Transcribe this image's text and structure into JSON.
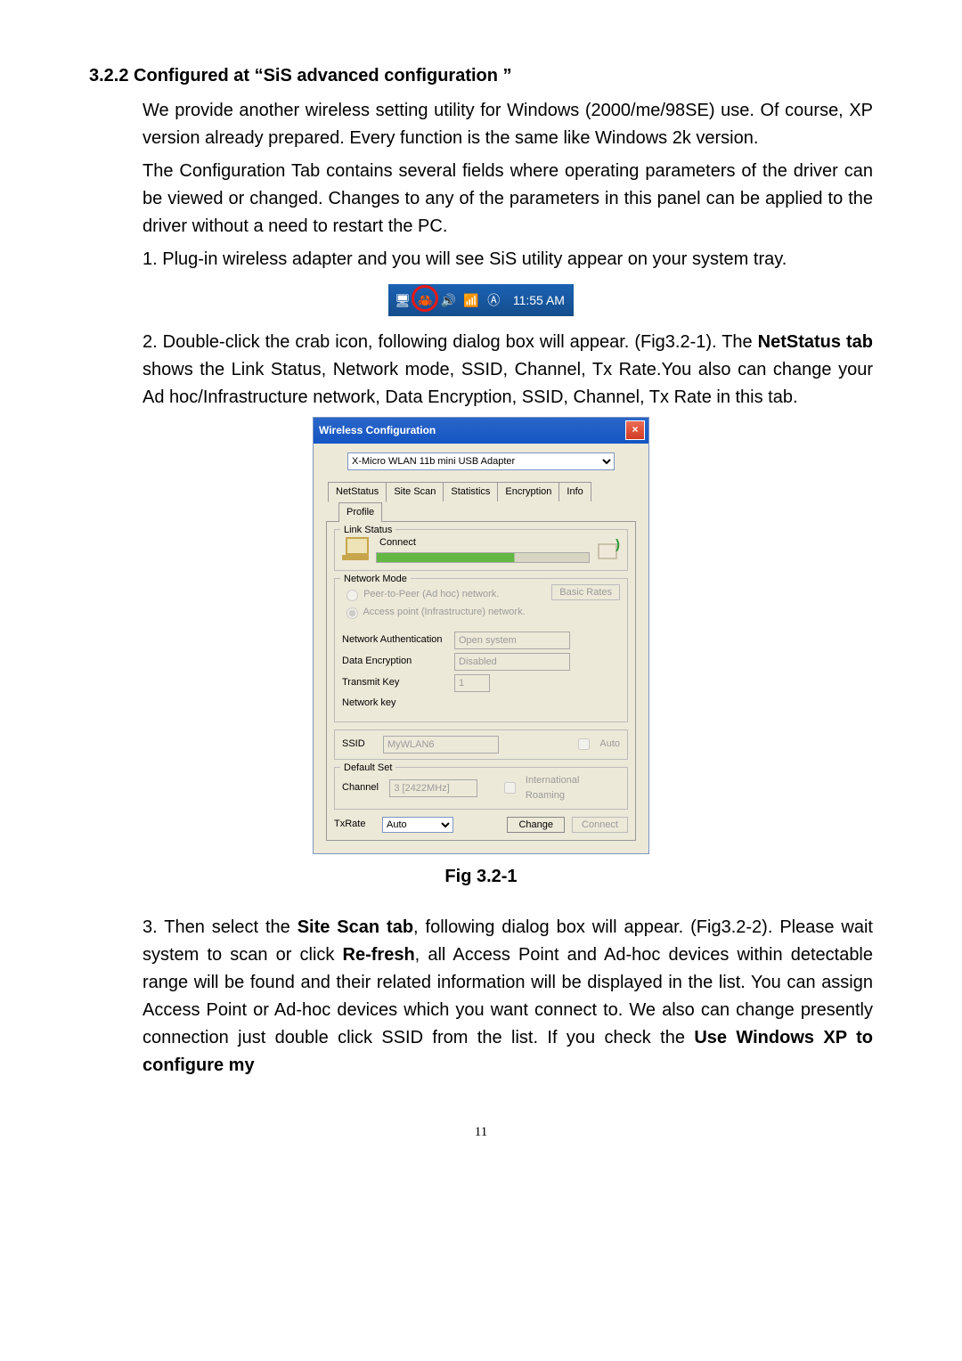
{
  "section_heading": "3.2.2 Configured at “SiS advanced configuration ”",
  "p1": "We provide another wireless setting utility for Windows (2000/me/98SE) use. Of course, XP version already prepared. Every function is the same like Windows 2k version.",
  "p2": "The Configuration Tab contains several fields where operating parameters of the driver can be viewed or changed. Changes to any of the parameters in this panel can be applied to the driver without a need to restart the PC.",
  "p3": "1. Plug-in wireless adapter and you will see SiS utility appear on your system tray.",
  "tray_time": "11:55 AM",
  "p4_pre": "2. Double-click the crab icon, following dialog box will appear. (Fig3.2-1). The ",
  "p4_bold": "NetStatus tab",
  "p4_post": " shows the Link Status, Network mode, SSID, Channel, Tx Rate.You also can change your Ad hoc/Infrastructure network, Data Encryption, SSID, Channel, Tx Rate in this tab.",
  "dialog": {
    "title": "Wireless Configuration",
    "adapter": "X-Micro WLAN 11b mini USB Adapter",
    "tabs": [
      "NetStatus",
      "Site Scan",
      "Statistics",
      "Encryption",
      "Info",
      "Profile"
    ],
    "group_link": "Link Status",
    "link_state": "Connect",
    "group_mode": "Network Mode",
    "mode_r1": "Peer-to-Peer (Ad hoc) network.",
    "mode_r2": "Access point (Infrastructure) network.",
    "btn_rates": "Basic Rates",
    "lbl_auth": "Network Authentication",
    "val_auth": "Open system",
    "lbl_enc": "Data Encryption",
    "val_enc": "Disabled",
    "lbl_txkey": "Transmit Key",
    "val_txkey": "1",
    "lbl_netkey": "Network key",
    "lbl_ssid": "SSID",
    "val_ssid": "MyWLAN6",
    "chk_auto": "Auto",
    "group_default": "Default Set",
    "lbl_channel": "Channel",
    "val_channel": "3  [2422MHz]",
    "chk_roam": "International Roaming",
    "lbl_txrate": "TxRate",
    "val_txrate": "Auto",
    "btn_change": "Change",
    "btn_connect": "Connect"
  },
  "figcaption": "Fig 3.2-1",
  "p5_pre": "3. Then select the ",
  "p5_b1": "Site Scan tab",
  "p5_mid1": ", following dialog box will appear. (Fig3.2-2). Please wait system to scan or click ",
  "p5_b2": "Re-fresh",
  "p5_mid2": ", all Access Point and Ad-hoc devices within detectable range will be found and their related information will be displayed in the list. You can assign Access Point or Ad-hoc devices which you want connect to. We also can change presently connection just double click SSID from the list. If you check the ",
  "p5_b3": "Use Windows XP to configure my",
  "page_number": "11"
}
